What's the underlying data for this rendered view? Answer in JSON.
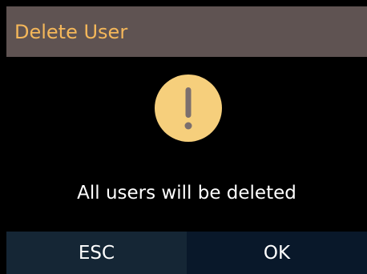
{
  "dialog": {
    "title": "Delete User",
    "message": "All users will be deleted",
    "icon": "exclamation-warning-icon"
  },
  "buttons": {
    "esc_label": "ESC",
    "ok_label": "OK"
  },
  "colors": {
    "title_bar_bg": "#5f5352",
    "title_text": "#f4b75a",
    "icon_fill": "#f6cf7c",
    "icon_glyph": "#7b6f6e",
    "background": "#000000",
    "esc_bg": "#152635",
    "ok_bg": "#09182a"
  }
}
